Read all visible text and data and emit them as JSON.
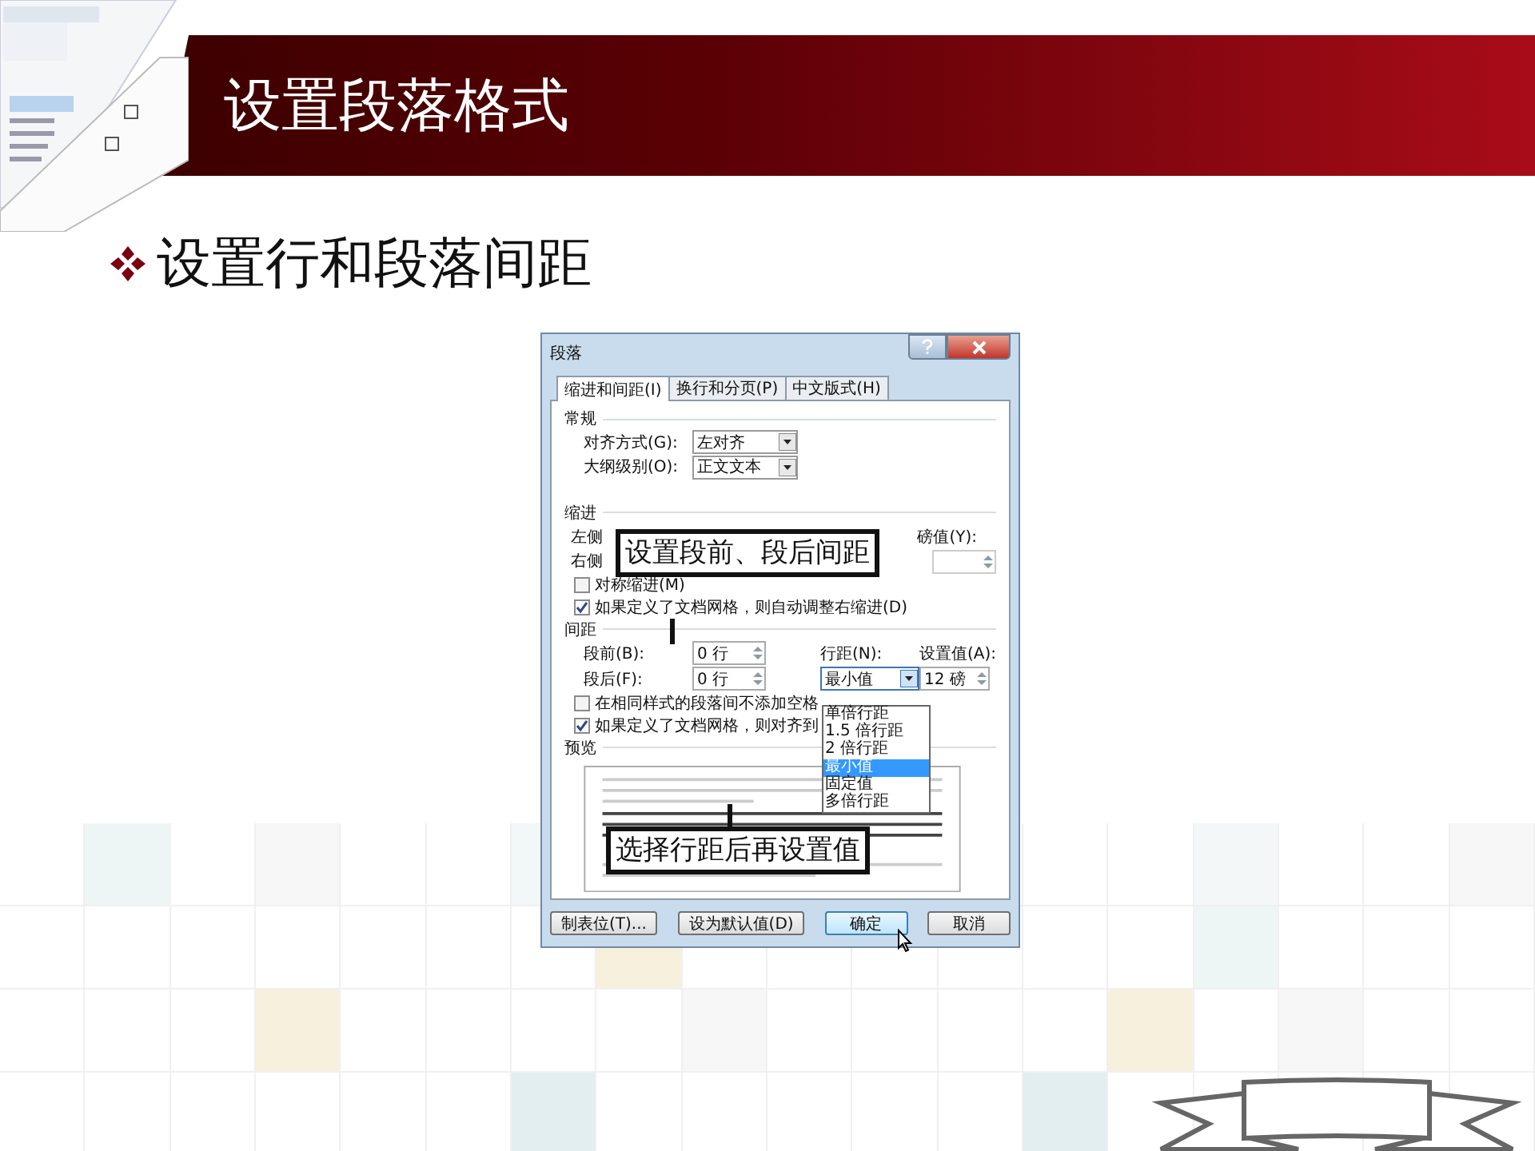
{
  "slide": {
    "title": "设置段落格式",
    "bullet": "设置行和段落间距"
  },
  "dialog": {
    "title": "段落",
    "tabs": [
      {
        "label": "缩进和间距(I)",
        "selected": true
      },
      {
        "label": "换行和分页(P)",
        "selected": false
      },
      {
        "label": "中文版式(H)",
        "selected": false
      }
    ],
    "general": {
      "heading": "常规",
      "fields": [
        {
          "label": "对齐方式(G):",
          "value": "左对齐"
        },
        {
          "label": "大纲级别(O):",
          "value": "正文文本"
        }
      ]
    },
    "indent": {
      "heading": "缩进",
      "left_label": "左侧",
      "right_label": "右侧",
      "value_label": "磅值(Y):",
      "checkboxes": [
        {
          "label": "对称缩进(M)",
          "checked": false
        },
        {
          "label": "如果定义了文档网格，则自动调整右缩进(D)",
          "checked": true
        }
      ]
    },
    "spacing": {
      "heading": "间距",
      "before_label": "段前(B):",
      "before_value": "0 行",
      "after_label": "段后(F):",
      "after_value": "0 行",
      "line_label": "行距(N):",
      "line_value": "最小值",
      "at_label": "设置值(A):",
      "at_value": "12 磅",
      "line_options": [
        {
          "label": "单倍行距",
          "selected": false
        },
        {
          "label": "1.5 倍行距",
          "selected": false
        },
        {
          "label": "2 倍行距",
          "selected": false
        },
        {
          "label": "最小值",
          "selected": true
        },
        {
          "label": "固定值",
          "selected": false
        },
        {
          "label": "多倍行距",
          "selected": false
        }
      ],
      "checkboxes": [
        {
          "label": "在相同样式的段落间不添加空格",
          "checked": false
        },
        {
          "label": "如果定义了文档网格，则对齐到",
          "checked": true
        }
      ]
    },
    "preview": {
      "heading": "预览"
    },
    "buttons": [
      {
        "label": "制表位(T)...",
        "default": false
      },
      {
        "label": "设为默认值(D)",
        "default": false
      },
      {
        "label": "确定",
        "default": true
      },
      {
        "label": "取消",
        "default": false
      }
    ]
  },
  "callouts": [
    "设置段前、段后间距",
    "选择行距后再设置值"
  ]
}
